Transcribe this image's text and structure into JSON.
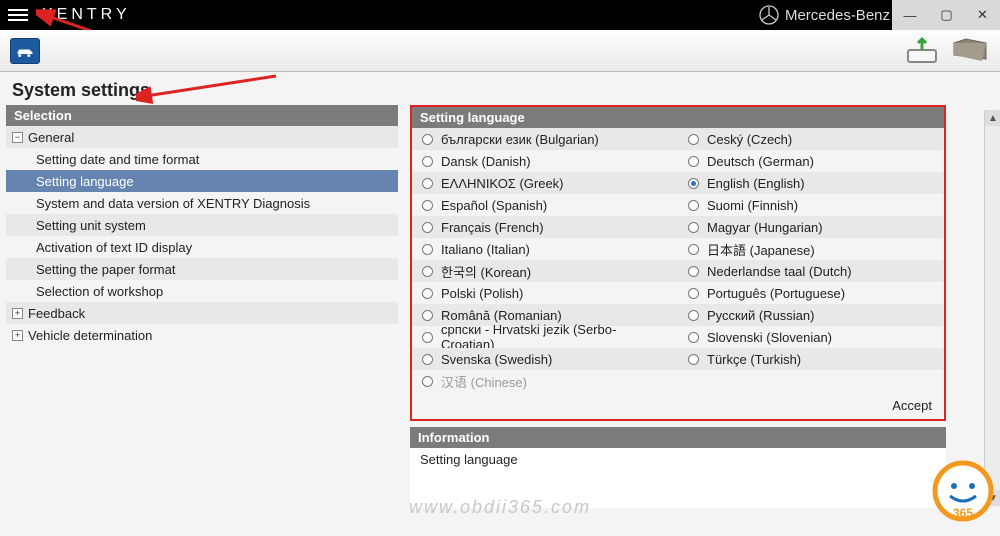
{
  "app": {
    "title": "XENTRY",
    "brand": "Mercedes-Benz"
  },
  "window": {
    "minimize": "—",
    "maximize": "▢",
    "close": "✕"
  },
  "page": {
    "title": "System settings",
    "selection_header": "Selection",
    "setting_language_header": "Setting language",
    "information_header": "Information",
    "information_body": "Setting language",
    "accept_label": "Accept"
  },
  "tree": {
    "groups": [
      {
        "label": "General",
        "expanded": true,
        "indicator": "−"
      },
      {
        "label": "Feedback",
        "expanded": false,
        "indicator": "+"
      },
      {
        "label": "Vehicle determination",
        "expanded": false,
        "indicator": "+"
      }
    ],
    "general_items": [
      {
        "label": "Setting date and time format",
        "selected": false
      },
      {
        "label": "Setting language",
        "selected": true
      },
      {
        "label": "System and data version of XENTRY Diagnosis",
        "selected": false
      },
      {
        "label": "Setting unit system",
        "selected": false
      },
      {
        "label": "Activation of text ID display",
        "selected": false
      },
      {
        "label": "Setting the paper format",
        "selected": false
      },
      {
        "label": "Selection of workshop",
        "selected": false
      }
    ]
  },
  "languages": {
    "rows": [
      {
        "left": {
          "label": "български език (Bulgarian)",
          "checked": false,
          "disabled": false
        },
        "right": {
          "label": "Ceský (Czech)",
          "checked": false,
          "disabled": false
        }
      },
      {
        "left": {
          "label": "Dansk (Danish)",
          "checked": false,
          "disabled": false
        },
        "right": {
          "label": "Deutsch (German)",
          "checked": false,
          "disabled": false
        }
      },
      {
        "left": {
          "label": "ΕΛΛΗΝΙΚΟΣ (Greek)",
          "checked": false,
          "disabled": false
        },
        "right": {
          "label": "English (English)",
          "checked": true,
          "disabled": false
        }
      },
      {
        "left": {
          "label": "Español (Spanish)",
          "checked": false,
          "disabled": false
        },
        "right": {
          "label": "Suomi (Finnish)",
          "checked": false,
          "disabled": false
        }
      },
      {
        "left": {
          "label": "Français (French)",
          "checked": false,
          "disabled": false
        },
        "right": {
          "label": "Magyar (Hungarian)",
          "checked": false,
          "disabled": false
        }
      },
      {
        "left": {
          "label": "Italiano (Italian)",
          "checked": false,
          "disabled": false
        },
        "right": {
          "label": "日本語 (Japanese)",
          "checked": false,
          "disabled": false
        }
      },
      {
        "left": {
          "label": "한국의 (Korean)",
          "checked": false,
          "disabled": false
        },
        "right": {
          "label": "Nederlandse taal (Dutch)",
          "checked": false,
          "disabled": false
        }
      },
      {
        "left": {
          "label": "Polski (Polish)",
          "checked": false,
          "disabled": false
        },
        "right": {
          "label": "Português (Portuguese)",
          "checked": false,
          "disabled": false
        }
      },
      {
        "left": {
          "label": "Română (Romanian)",
          "checked": false,
          "disabled": false
        },
        "right": {
          "label": "Русский (Russian)",
          "checked": false,
          "disabled": false
        }
      },
      {
        "left": {
          "label": "српски - Hrvatski jezik (Serbo-Croatian)",
          "checked": false,
          "disabled": false
        },
        "right": {
          "label": "Slovenski (Slovenian)",
          "checked": false,
          "disabled": false
        }
      },
      {
        "left": {
          "label": "Svenska (Swedish)",
          "checked": false,
          "disabled": false
        },
        "right": {
          "label": "Türkçe (Turkish)",
          "checked": false,
          "disabled": false
        }
      },
      {
        "left": {
          "label": "汉语 (Chinese)",
          "checked": false,
          "disabled": true
        },
        "right": {
          "label": "",
          "checked": false,
          "disabled": true
        }
      }
    ]
  },
  "watermark": "www.obdii365.com"
}
